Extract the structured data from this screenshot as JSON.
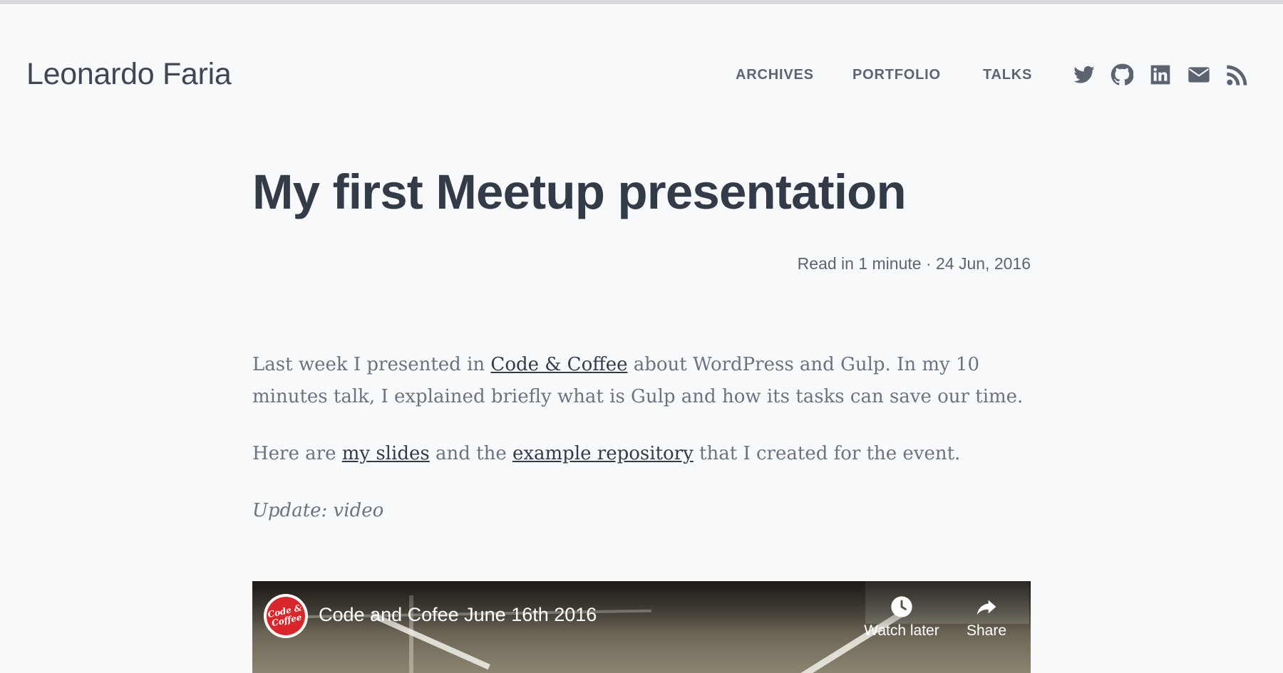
{
  "header": {
    "logo": "Leonardo Faria",
    "nav": [
      {
        "label": "ARCHIVES"
      },
      {
        "label": "PORTFOLIO"
      },
      {
        "label": "TALKS"
      }
    ],
    "social_icons": [
      "twitter-icon",
      "github-icon",
      "linkedin-icon",
      "email-icon",
      "rss-icon"
    ]
  },
  "post": {
    "title": "My first Meetup presentation",
    "meta": "Read in 1 minute · 24 Jun, 2016",
    "p1": {
      "before": "Last week I presented in ",
      "link": "Code & Coffee",
      "after": " about WordPress and Gulp. In my 10 minutes talk, I explained briefly what is Gulp and how its tasks can save our time."
    },
    "p2": {
      "before": "Here are ",
      "link1": "my slides",
      "middle": " and the ",
      "link2": "example repository",
      "after": " that I created for the event."
    },
    "update": "Update: video"
  },
  "video": {
    "channel_logo_text": "Code & Coffee",
    "title": "Code and Cofee June 16th 2016",
    "watch_later": "Watch later",
    "share": "Share"
  },
  "colors": {
    "background": "#f8f9fb",
    "heading": "#333b49",
    "nav": "#5d6471",
    "body_text": "#6c7380",
    "channel_red": "#d8262c"
  }
}
